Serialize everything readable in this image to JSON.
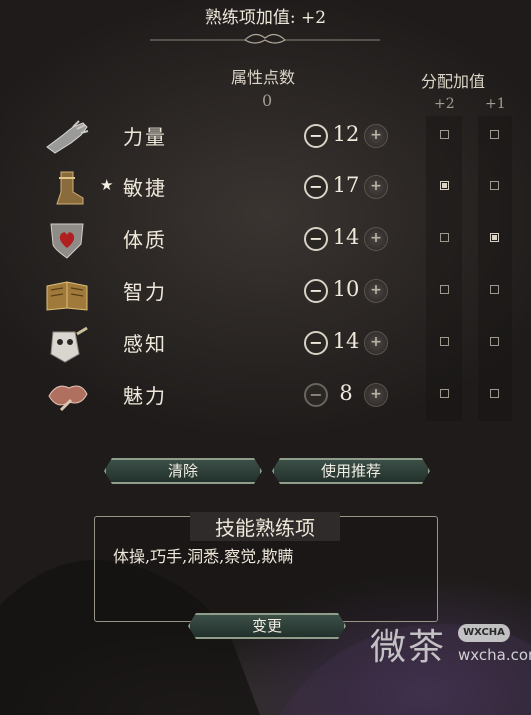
{
  "header": {
    "title": "熟练项加值: +2"
  },
  "points": {
    "label": "属性点数",
    "value": "0"
  },
  "bonus": {
    "label": "分配加值",
    "col_plus2": "+2",
    "col_plus1": "+1"
  },
  "abilities": [
    {
      "name": "力量",
      "value": "12",
      "starred": false,
      "icon": "strength-gauntlet-icon",
      "plus2": false,
      "plus1": false
    },
    {
      "name": "敏捷",
      "value": "17",
      "starred": true,
      "icon": "dexterity-boot-icon",
      "plus2": true,
      "plus1": false
    },
    {
      "name": "体质",
      "value": "14",
      "starred": false,
      "icon": "constitution-heart-shield-icon",
      "plus2": false,
      "plus1": true
    },
    {
      "name": "智力",
      "value": "10",
      "starred": false,
      "icon": "intelligence-book-icon",
      "plus2": false,
      "plus1": false
    },
    {
      "name": "感知",
      "value": "14",
      "starred": false,
      "icon": "wisdom-owl-icon",
      "plus2": false,
      "plus1": false
    },
    {
      "name": "魅力",
      "value": "8",
      "starred": false,
      "icon": "charisma-mask-icon",
      "plus2": false,
      "plus1": false
    }
  ],
  "star_symbol": "★",
  "buttons": {
    "clear": "清除",
    "recommend": "使用推荐",
    "change": "变更"
  },
  "skills": {
    "title": "技能熟练项",
    "list": "体操,巧手,洞悉,察觉,欺瞒"
  },
  "watermark": {
    "text": "微茶",
    "badge": "WXCHA",
    "url": "wxcha.com"
  }
}
